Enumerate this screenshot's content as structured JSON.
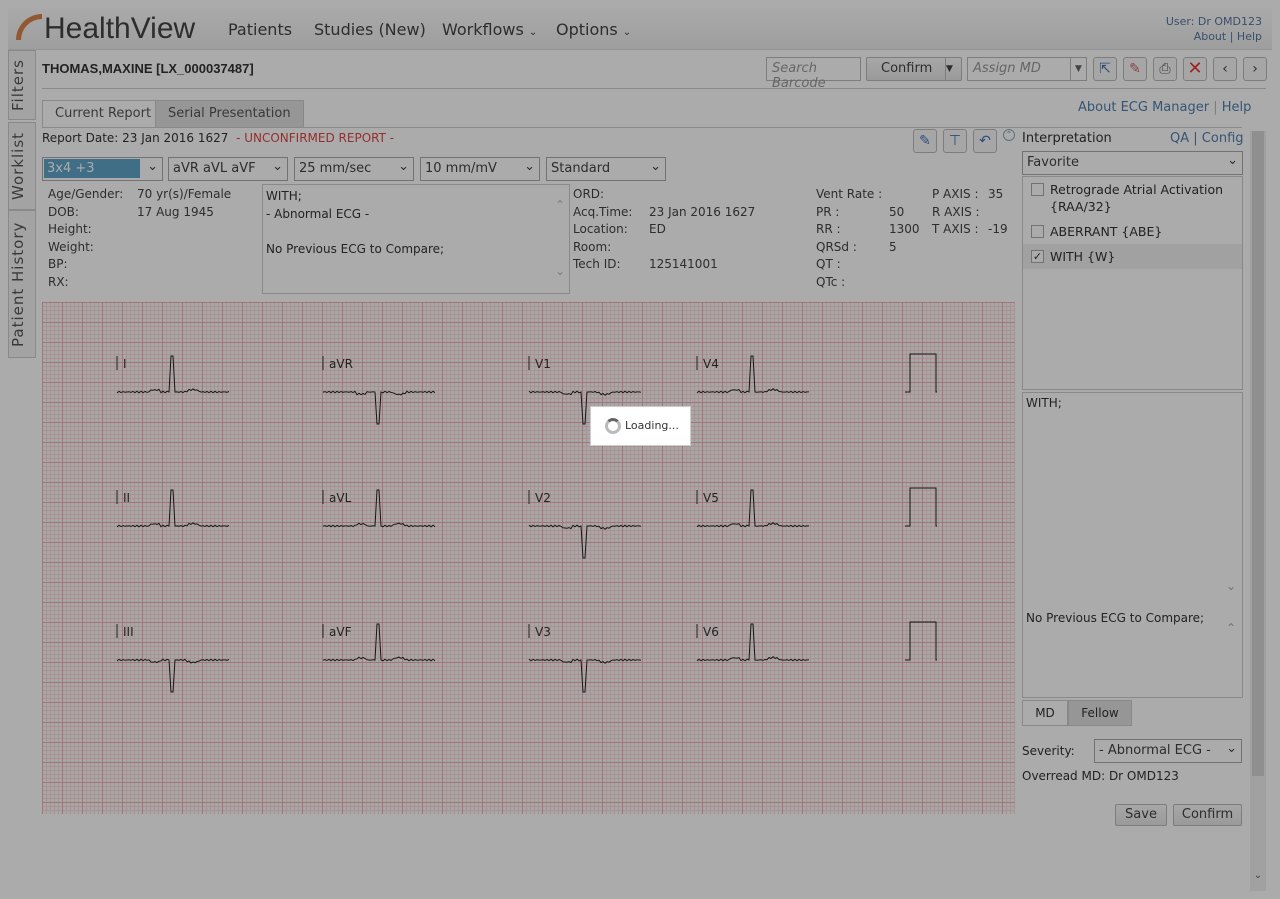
{
  "app": {
    "logo": "HealthView",
    "nav": [
      "Patients",
      "Studies (New)",
      "Workflows",
      "Options"
    ],
    "user": "User: Dr OMD123",
    "about": "About",
    "help": "Help"
  },
  "sidetabs": [
    "Filters",
    "Worklist",
    "Patient History"
  ],
  "patient": "THOMAS,MAXINE [LX_000037487]",
  "toolbar": {
    "search_placeholder": "Search Barcode",
    "confirm": "Confirm",
    "assign_placeholder": "Assign MD"
  },
  "tabs": [
    "Current Report",
    "Serial Presentation"
  ],
  "links": {
    "about_ecg": "About ECG Manager",
    "help": "Help"
  },
  "report": {
    "date": "Report Date: 23 Jan 2016 1627",
    "status": "- UNCONFIRMED REPORT -"
  },
  "selects": {
    "layout": "3x4 +3",
    "leads": "aVR aVL aVF",
    "speed": "25 mm/sec",
    "gain": "10 mm/mV",
    "filter": "Standard"
  },
  "demographics": [
    [
      "Age/Gender:",
      "70 yr(s)/Female"
    ],
    [
      "DOB:",
      "17 Aug 1945"
    ],
    [
      "Height:",
      ""
    ],
    [
      "Weight:",
      ""
    ],
    [
      "BP:",
      ""
    ],
    [
      "RX:",
      ""
    ]
  ],
  "notes": [
    "WITH;",
    "- Abnormal ECG -",
    "",
    "No Previous ECG to Compare;"
  ],
  "acquisition": [
    [
      "ORD:",
      ""
    ],
    [
      "Acq.Time:",
      "23 Jan 2016 1627"
    ],
    [
      "Location:",
      "ED"
    ],
    [
      "Room:",
      ""
    ],
    [
      "Tech ID:",
      "125141001"
    ]
  ],
  "measurements": [
    [
      "Vent Rate :",
      ""
    ],
    [
      "PR :",
      "50"
    ],
    [
      "RR :",
      "1300"
    ],
    [
      "QRSd :",
      "5"
    ],
    [
      "QT :",
      ""
    ],
    [
      "QTc :",
      ""
    ]
  ],
  "axes": [
    [
      "P AXIS :",
      "35"
    ],
    [
      "R AXIS :",
      ""
    ],
    [
      "T AXIS :",
      "-19"
    ]
  ],
  "leads": [
    [
      "I",
      "aVR",
      "V1",
      "V4"
    ],
    [
      "II",
      "aVL",
      "V2",
      "V5"
    ],
    [
      "III",
      "aVF",
      "V3",
      "V6"
    ]
  ],
  "lead_polarity": [
    [
      1,
      -1,
      -1,
      1
    ],
    [
      1,
      1,
      -1,
      1
    ],
    [
      -1,
      1,
      -1,
      1
    ]
  ],
  "loading": "Loading...",
  "interp": {
    "title": "Interpretation",
    "qa": "QA",
    "config": "Config",
    "favorite": "Favorite",
    "items": [
      {
        "label": "Retrograde Atrial Activation {RAA/32}",
        "checked": false
      },
      {
        "label": "ABERRANT {ABE}",
        "checked": false
      },
      {
        "label": "WITH {W}",
        "checked": true
      }
    ],
    "text1": "WITH;",
    "text2": "No Previous ECG to Compare;",
    "md": "MD",
    "fellow": "Fellow",
    "severity_label": "Severity:",
    "severity": "- Abnormal ECG -",
    "overread": "Overread MD: Dr OMD123",
    "save": "Save",
    "confirm": "Confirm"
  }
}
